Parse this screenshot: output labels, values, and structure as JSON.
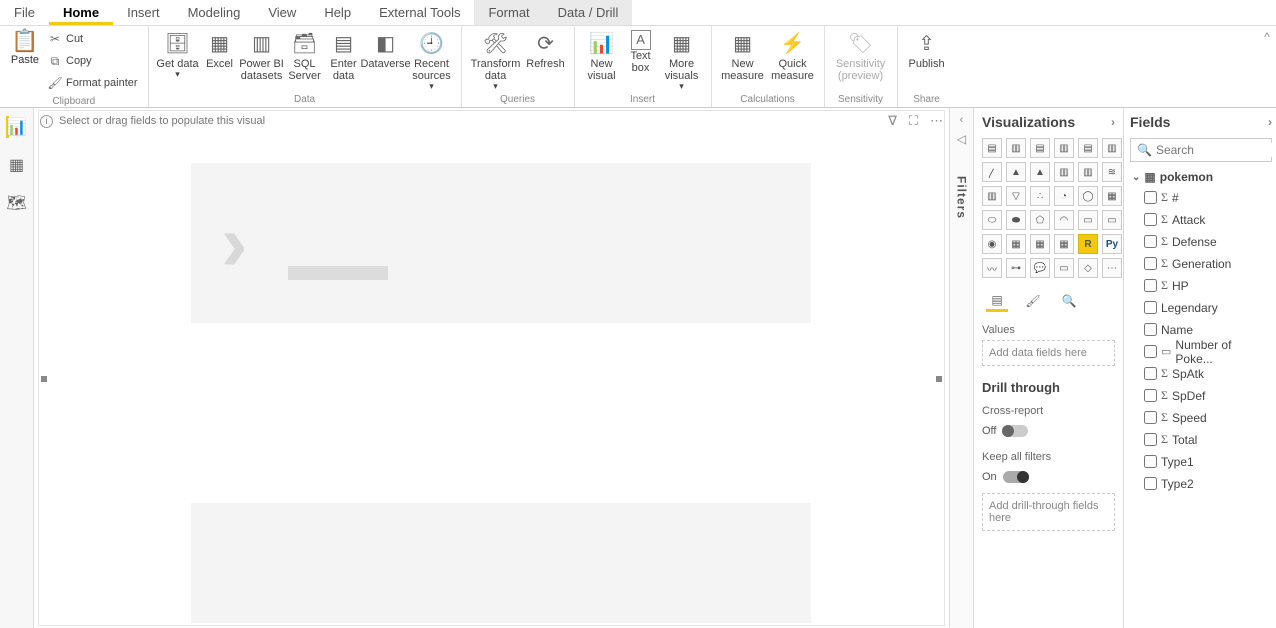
{
  "menu": {
    "items": [
      "File",
      "Home",
      "Insert",
      "Modeling",
      "View",
      "Help",
      "External Tools",
      "Format",
      "Data / Drill"
    ],
    "active_index": 1,
    "highlight_indices": [
      7,
      8
    ]
  },
  "ribbon": {
    "clipboard": {
      "paste": "Paste",
      "cut": "Cut",
      "copy": "Copy",
      "format_painter": "Format painter",
      "group": "Clipboard"
    },
    "data": {
      "get_data": "Get data",
      "excel": "Excel",
      "pbi_datasets": "Power BI datasets",
      "sql": "SQL Server",
      "enter": "Enter data",
      "dataverse": "Dataverse",
      "recent": "Recent sources",
      "group": "Data"
    },
    "queries": {
      "transform": "Transform data",
      "refresh": "Refresh",
      "group": "Queries"
    },
    "insert": {
      "new_visual": "New visual",
      "text_box": "Text box",
      "more": "More visuals",
      "group": "Insert"
    },
    "calc": {
      "new_measure": "New measure",
      "quick": "Quick measure",
      "group": "Calculations"
    },
    "sensitivity": {
      "label": "Sensitivity (preview)",
      "group": "Sensitivity"
    },
    "share": {
      "publish": "Publish",
      "group": "Share"
    }
  },
  "canvas": {
    "hint": "Select or drag fields to populate this visual"
  },
  "filters": {
    "label": "Filters"
  },
  "visualizations": {
    "title": "Visualizations",
    "values_label": "Values",
    "values_placeholder": "Add data fields here",
    "drill_title": "Drill through",
    "cross_label": "Cross-report",
    "cross_state": "Off",
    "keep_label": "Keep all filters",
    "keep_state": "On",
    "drill_placeholder": "Add drill-through fields here",
    "selected": "R",
    "py": "Py"
  },
  "fields": {
    "title": "Fields",
    "search_placeholder": "Search",
    "table": "pokemon",
    "items": [
      {
        "name": "#",
        "sigma": true
      },
      {
        "name": "Attack",
        "sigma": true
      },
      {
        "name": "Defense",
        "sigma": true
      },
      {
        "name": "Generation",
        "sigma": true
      },
      {
        "name": "HP",
        "sigma": true
      },
      {
        "name": "Legendary",
        "sigma": false
      },
      {
        "name": "Name",
        "sigma": false
      },
      {
        "name": "Number of Poke...",
        "fx": true
      },
      {
        "name": "SpAtk",
        "sigma": true
      },
      {
        "name": "SpDef",
        "sigma": true
      },
      {
        "name": "Speed",
        "sigma": true
      },
      {
        "name": "Total",
        "sigma": true
      },
      {
        "name": "Type1",
        "sigma": false
      },
      {
        "name": "Type2",
        "sigma": false
      }
    ]
  }
}
